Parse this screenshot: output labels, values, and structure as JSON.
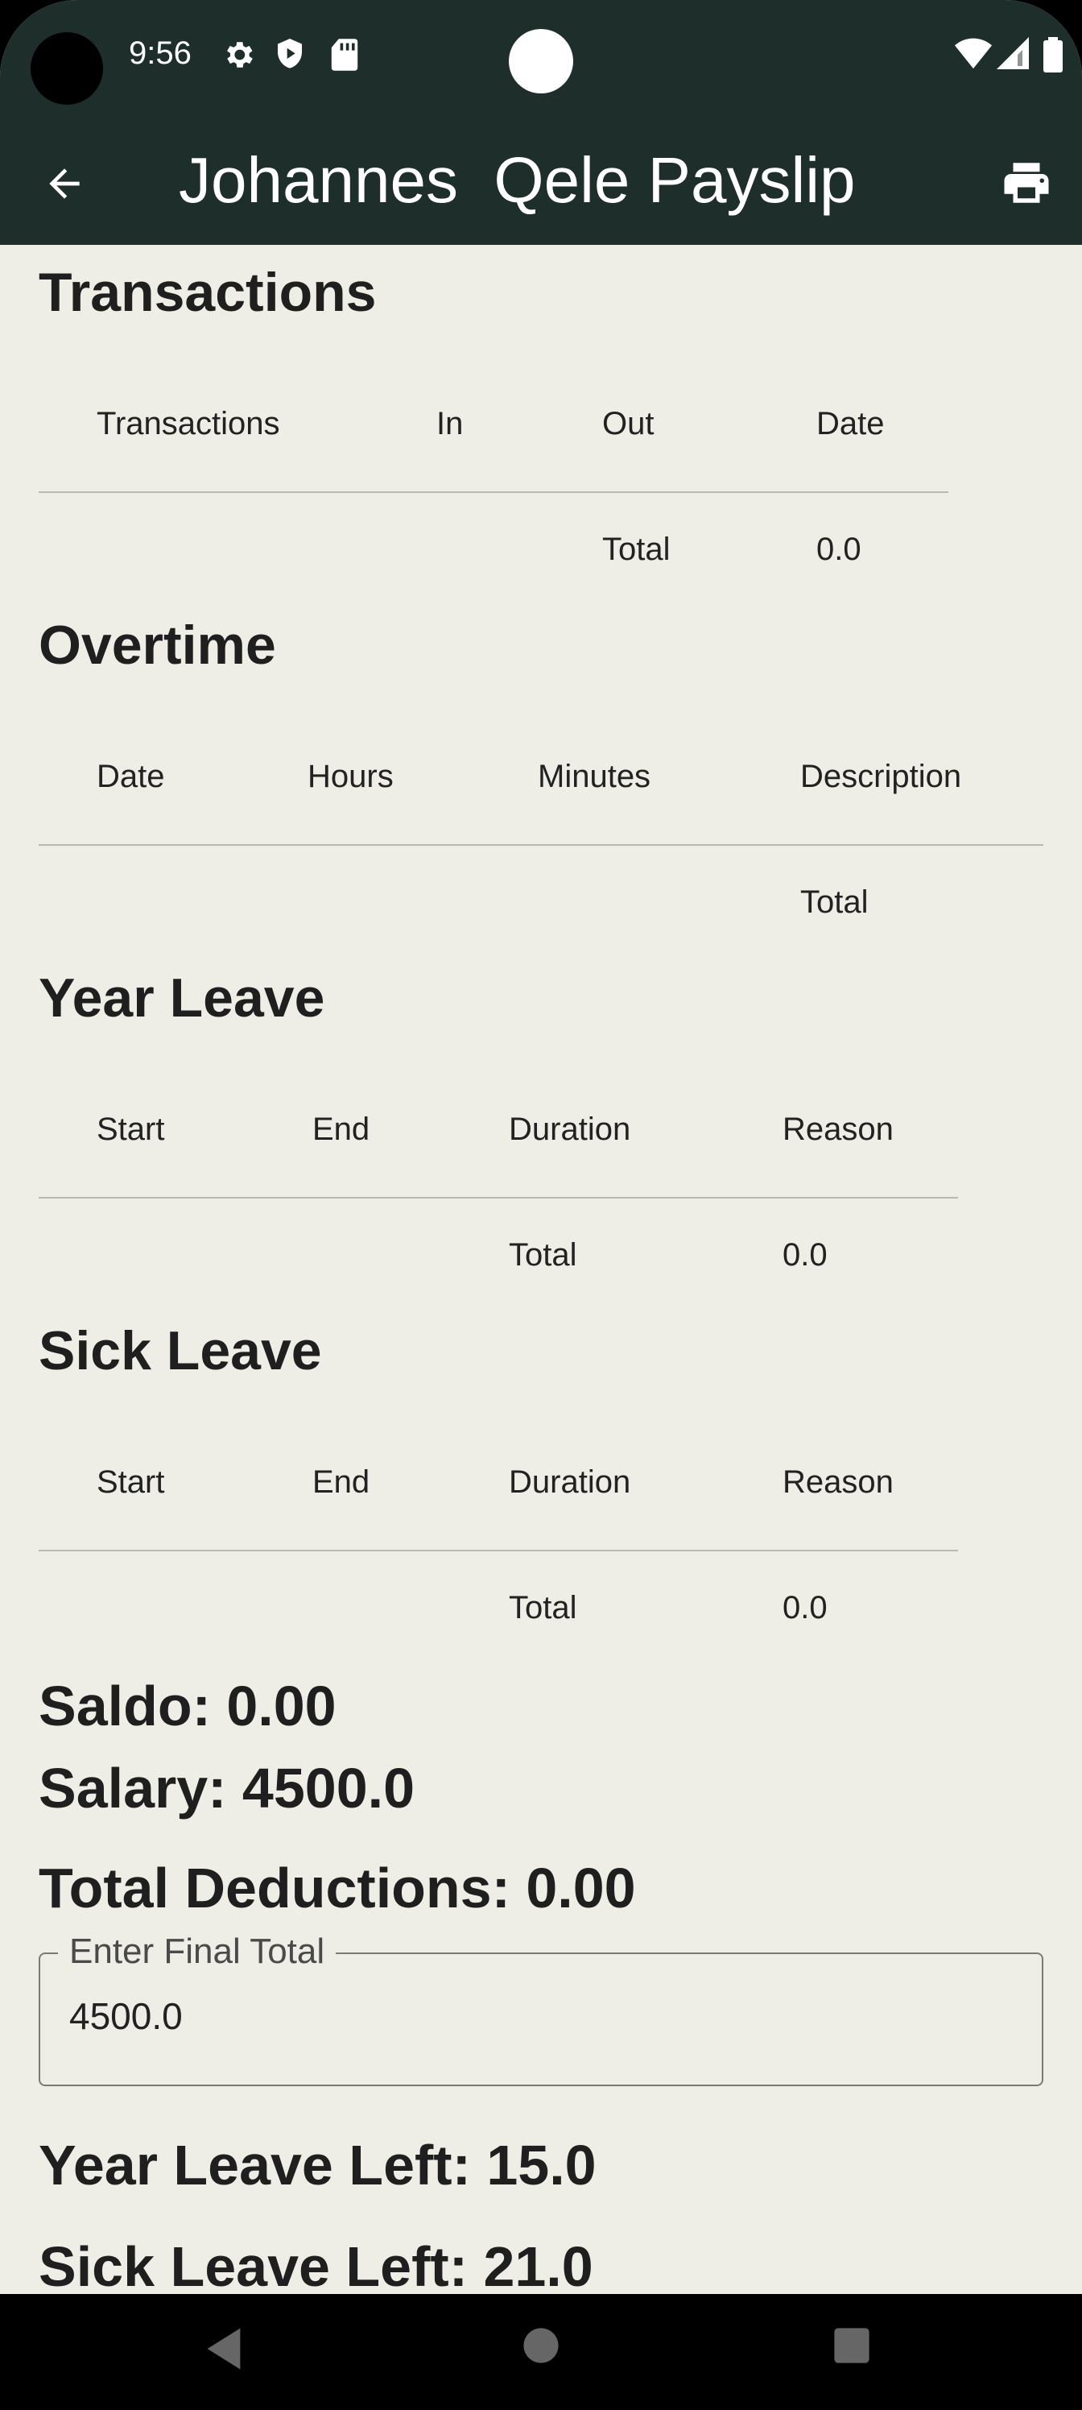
{
  "status_bar": {
    "time": "9:56",
    "icons": [
      "settings-icon",
      "shield-icon",
      "sd-card-icon",
      "wifi-icon",
      "signal-icon",
      "battery-icon"
    ]
  },
  "app_bar": {
    "title": "Johannes  Qele Payslip",
    "back_icon": "arrow-back-icon",
    "print_icon": "print-icon"
  },
  "transactions": {
    "heading": "Transactions",
    "columns": [
      "Transactions",
      "In",
      "Out",
      "Date"
    ],
    "total_label": "Total",
    "total_value": "0.0"
  },
  "overtime": {
    "heading": "Overtime",
    "columns": [
      "Date",
      "Hours",
      "Minutes",
      "Description"
    ],
    "total_label": "Total"
  },
  "year_leave": {
    "heading": "Year Leave",
    "columns": [
      "Start",
      "End",
      "Duration",
      "Reason"
    ],
    "total_label": "Total",
    "total_value": "0.0"
  },
  "sick_leave": {
    "heading": "Sick Leave",
    "columns": [
      "Start",
      "End",
      "Duration",
      "Reason"
    ],
    "total_label": "Total",
    "total_value": "0.0"
  },
  "summary": {
    "saldo": "Saldo: 0.00",
    "salary": "Salary: 4500.0",
    "total_deductions": "Total Deductions: 0.00",
    "final_total_label": "Enter Final Total",
    "final_total_value": "4500.0",
    "year_leave_left": "Year Leave Left: 15.0",
    "sick_leave_left": "Sick Leave Left: 21.0"
  },
  "colors": {
    "app_bar": "#1e2f2b",
    "background": "#eeeee6",
    "text": "#1f1f1f"
  }
}
